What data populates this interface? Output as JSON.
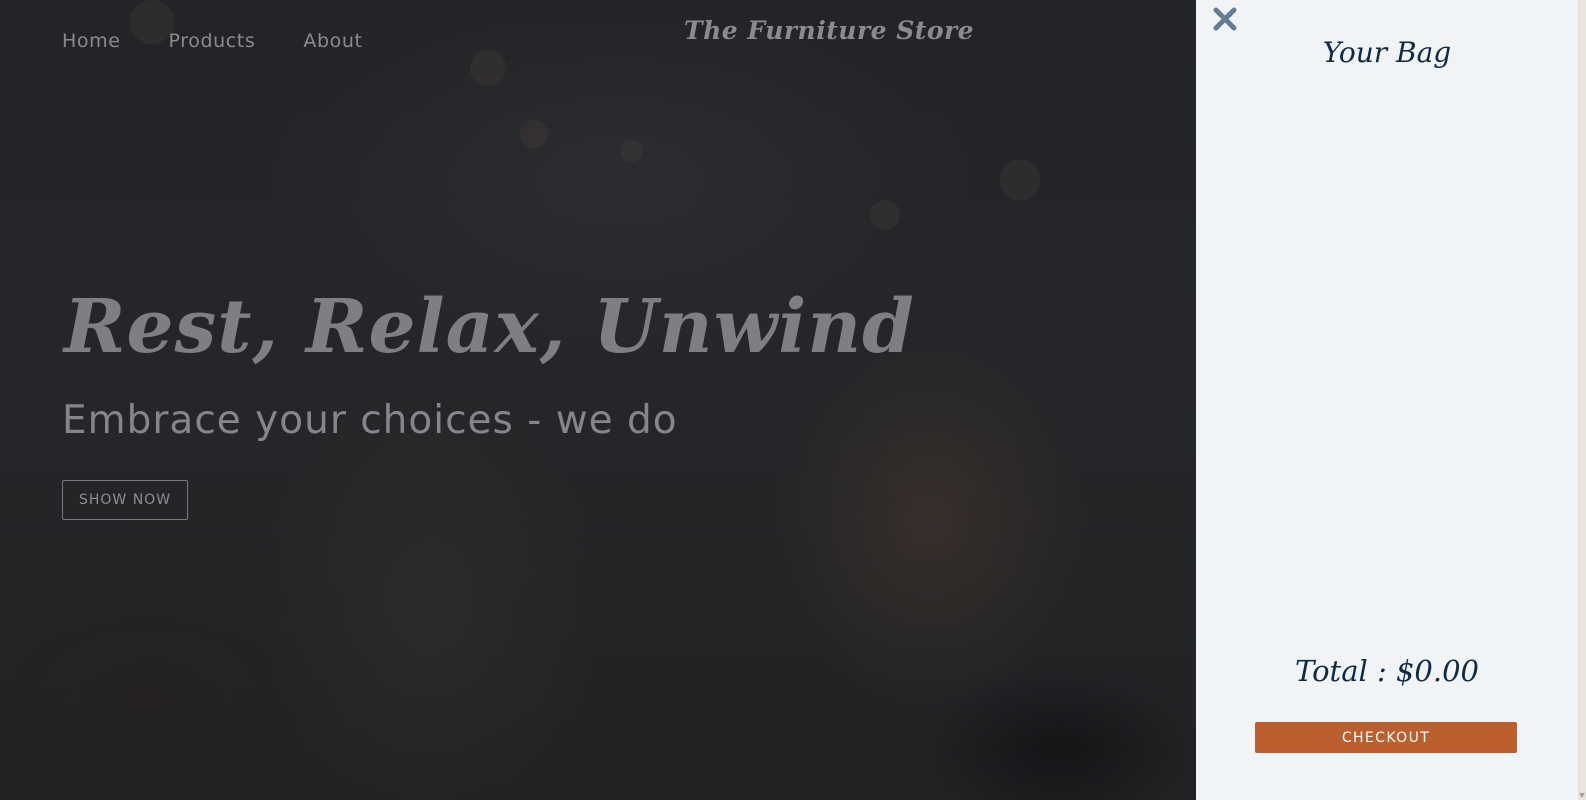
{
  "nav": {
    "links": [
      "Home",
      "Products",
      "About"
    ],
    "brand": "The Furniture Store"
  },
  "hero": {
    "title": "Rest, Relax, Unwind",
    "subtitle": "Embrace your choices - we do",
    "button_label": "SHOW NOW"
  },
  "cart": {
    "close_icon": "close-icon",
    "title": "Your Bag",
    "total": "Total : $0.00",
    "checkout_label": "CHECKOUT"
  },
  "colors": {
    "accent": "#bb5f2e",
    "cart_bg": "#f0f4f7",
    "cart_text": "#102a43",
    "close_icon": "#617d98"
  }
}
